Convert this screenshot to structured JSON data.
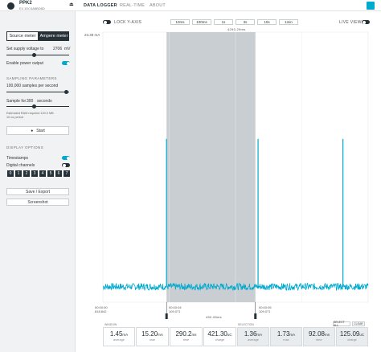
{
  "header": {
    "device_name": "PPK2",
    "device_serial": "E4 1DC4A8BD8D",
    "tabs": [
      "DATA LOGGER",
      "REAL-TIME",
      "ABOUT"
    ],
    "active_tab": "DATA LOGGER"
  },
  "sidebar": {
    "mode_title": "MODE",
    "mode_options": [
      "Source meter",
      "Ampere meter"
    ],
    "mode_selected": "Source meter",
    "supply_label": "Set supply voltage to",
    "supply_value": "2706",
    "supply_unit": "mV",
    "power_label": "Enable power output",
    "power_on": true,
    "sampling_title": "SAMPLING PARAMETERS",
    "rate_label": "100,000 samples per second",
    "sample_for_label": "Sample for",
    "sample_for_value": "300",
    "sample_for_unit": "seconds",
    "ram_note_1": "Estimated RAM required 120.0 MB",
    "ram_note_2": "10 us period",
    "start_label": "Start",
    "display_title": "DISPLAY OPTIONS",
    "timestamps_label": "Timestamps",
    "timestamps_on": true,
    "digital_label": "Digital channels",
    "digital_on": false,
    "channels": [
      "0",
      "1",
      "2",
      "3",
      "4",
      "5",
      "6",
      "7"
    ],
    "save_label": "Save / Export",
    "screenshot_label": "Screenshot"
  },
  "chart_controls": {
    "lock_label": "LOCK Y-AXIS",
    "live_label": "LIVE VIEW",
    "window_buttons": [
      "10ms",
      "100ms",
      "1s",
      "3s",
      "10s",
      "1min"
    ],
    "window_label": "4290.29ms",
    "selection_label": "450.08ms"
  },
  "chart_data": {
    "type": "line",
    "ylabel": "23.49 mA",
    "x_ticks": [
      {
        "time": "00:00:00",
        "ms": "818.842"
      },
      {
        "time": "00:00:04",
        "ms": "109.071"
      },
      {
        "time": "00:00:05",
        "ms": "109.071"
      }
    ],
    "ylim": [
      0,
      23.49
    ],
    "series": [
      {
        "baseline_mA": 1.35,
        "spikes_x_fraction": [
          0.24,
          0.585,
          0.905
        ],
        "spike_peak_mA": 14.2
      }
    ],
    "selection_x_fraction": [
      0.24,
      0.575
    ]
  },
  "stats": {
    "window_header": "WINDOW",
    "selection_header": "SELECTION",
    "select_all_label": "SELECT ALL",
    "clear_label": "CLEAR",
    "window": [
      {
        "value": "1.45",
        "unit": "mA",
        "name": "average"
      },
      {
        "value": "15.20",
        "unit": "mA",
        "name": "max"
      },
      {
        "value": "290.2",
        "unit": "ms",
        "name": "time"
      },
      {
        "value": "421.30",
        "unit": "uC",
        "name": "charge"
      }
    ],
    "selection": [
      {
        "value": "1.36",
        "unit": "mA",
        "name": "average"
      },
      {
        "value": "1.73",
        "unit": "mA",
        "name": "max"
      },
      {
        "value": "92.08",
        "unit": "ms",
        "name": "time"
      },
      {
        "value": "125.09",
        "unit": "uC",
        "name": "charge"
      }
    ]
  }
}
